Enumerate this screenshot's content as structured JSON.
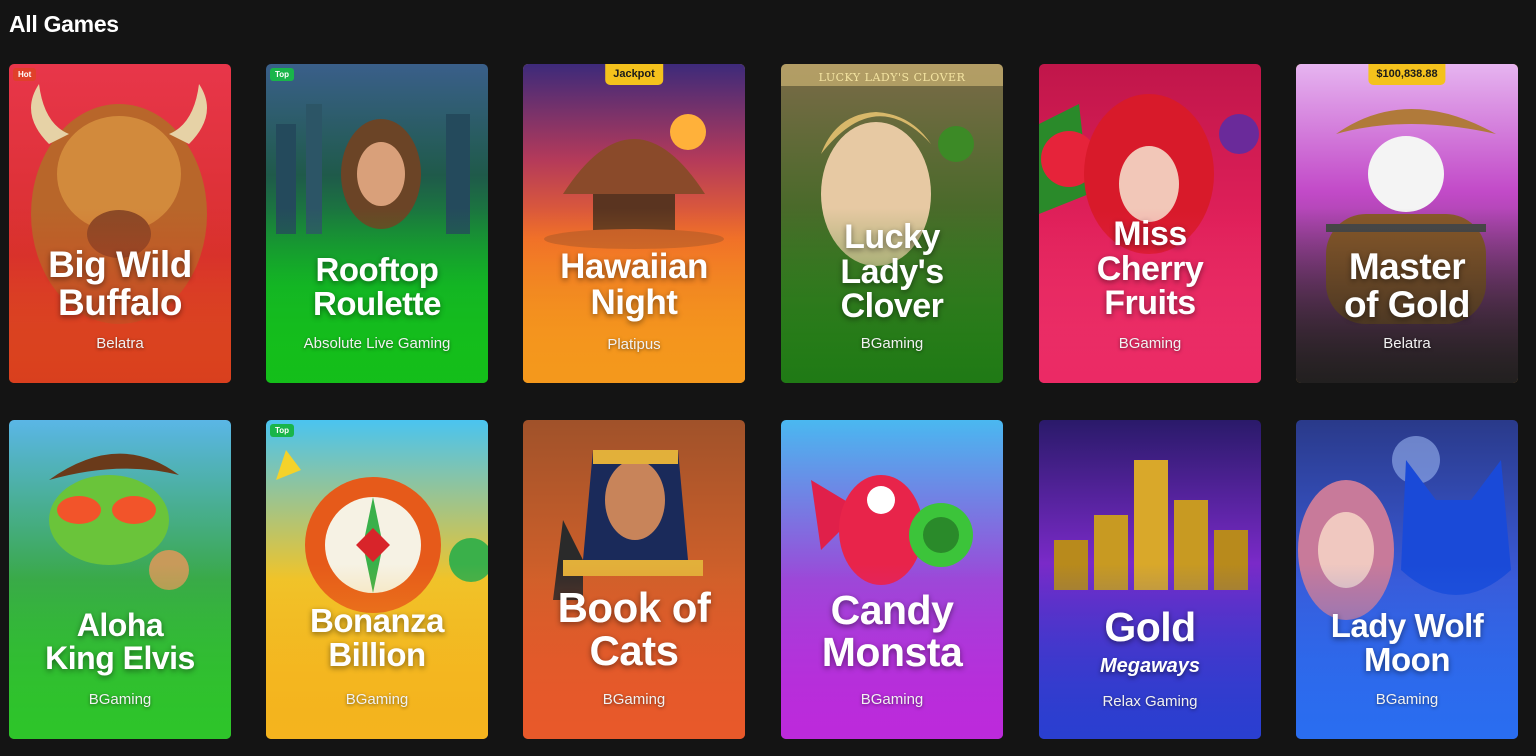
{
  "section": {
    "title": "All Games"
  },
  "games": [
    {
      "title": "Big Wild\nBuffalo",
      "provider": "Belatra",
      "badge": "Hot"
    },
    {
      "title": "Rooftop\nRoulette",
      "provider": "Absolute Live Gaming",
      "badge": "Top"
    },
    {
      "title": "Hawaiian\nNight",
      "provider": "Platipus",
      "tag": "Jackpot"
    },
    {
      "title": "Lucky\nLady's\nClover",
      "provider": "BGaming",
      "art_text": "LUCKY LADY'S CLOVER"
    },
    {
      "title": "Miss\nCherry\nFruits",
      "provider": "BGaming"
    },
    {
      "title": "Master\nof Gold",
      "provider": "Belatra",
      "tag": "$100,838.88"
    },
    {
      "title": "Aloha\nKing Elvis",
      "provider": "BGaming"
    },
    {
      "title": "Bonanza\nBillion",
      "provider": "BGaming",
      "badge": "Top"
    },
    {
      "title": "Book of\nCats",
      "provider": "BGaming"
    },
    {
      "title": "Candy\nMonsta",
      "provider": "BGaming"
    },
    {
      "title": "Gold",
      "subtitle": "Megaways",
      "provider": "Relax Gaming"
    },
    {
      "title": "Lady Wolf\nMoon",
      "provider": "BGaming"
    }
  ],
  "colors": {
    "page_bg": "#141414",
    "hot_badge": "#e0402a",
    "top_badge": "#19b54a",
    "jackpot_tag": "#f4c21c"
  }
}
